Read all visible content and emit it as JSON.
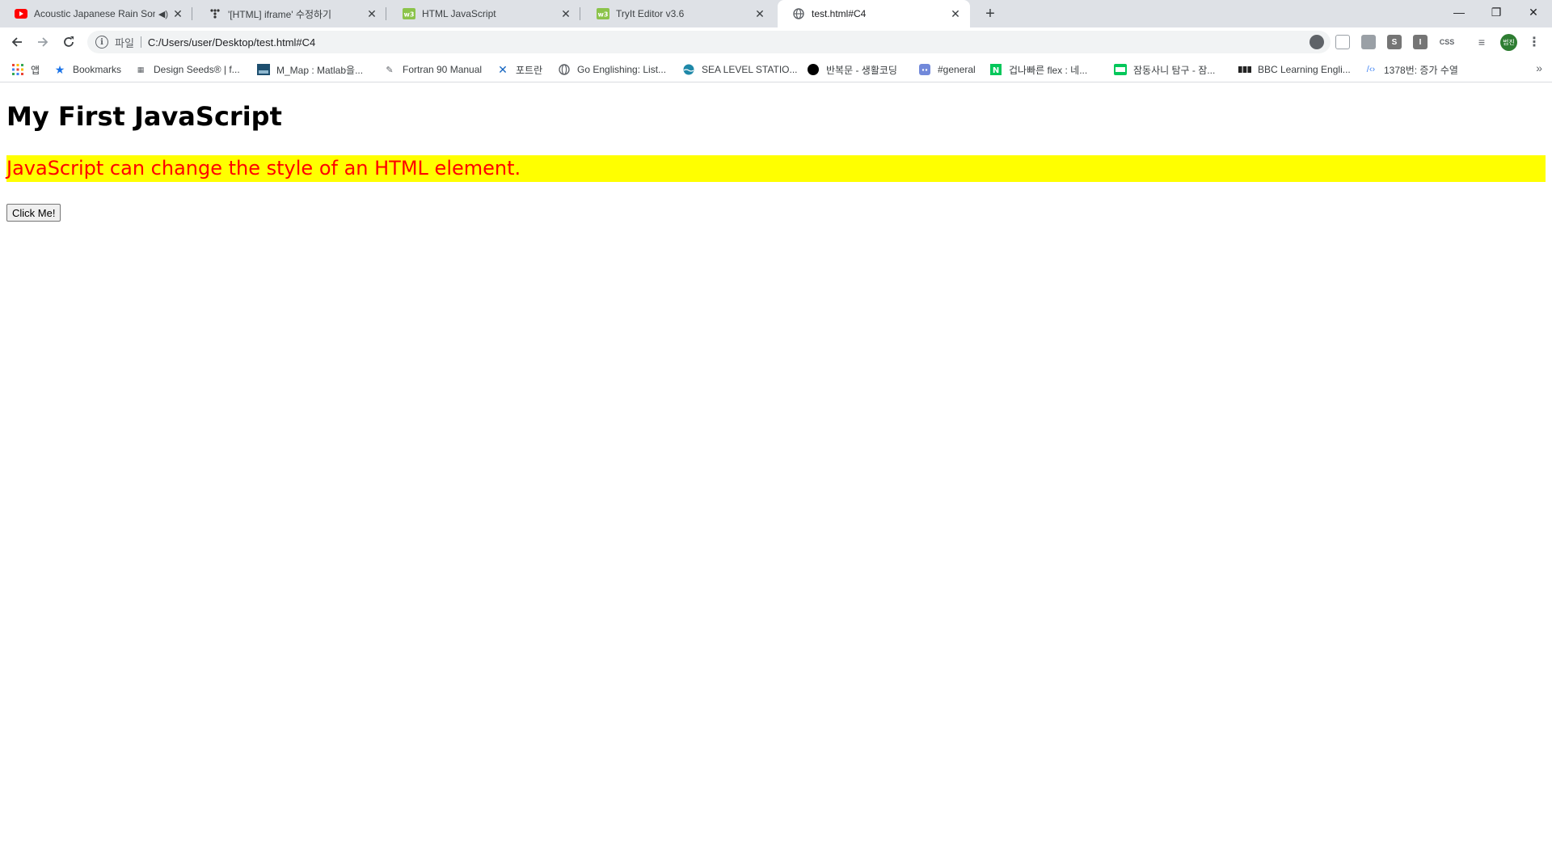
{
  "tabs": [
    {
      "title": "Acoustic Japanese Rain Son",
      "favicon": "youtube-icon",
      "audio": "speaker-icon"
    },
    {
      "title": "'[HTML] iframe' 수정하기",
      "favicon": "dots-icon"
    },
    {
      "title": "HTML JavaScript",
      "favicon": "w3schools-icon"
    },
    {
      "title": "TryIt Editor v3.6",
      "favicon": "w3schools-icon"
    },
    {
      "title": "test.html#C4",
      "favicon": "globe-icon",
      "active": true
    }
  ],
  "window": {
    "minimize": "—",
    "restore": "❐",
    "close": "✕",
    "new_tab": "+"
  },
  "omnibox": {
    "scheme_label": "파일",
    "url": "C:/Users/user/Desktop/test.html#C4"
  },
  "bookmarks": [
    {
      "label": "앱",
      "icon": "apps-grid-icon"
    },
    {
      "label": "Bookmarks",
      "icon": "star-icon"
    },
    {
      "label": "Design Seeds® | f...",
      "icon": "design-seeds-icon"
    },
    {
      "label": "M_Map : Matlab을...",
      "icon": "m-map-icon"
    },
    {
      "label": "Fortran 90 Manual",
      "icon": "fortran-icon"
    },
    {
      "label": "포트란",
      "icon": "cross-icon"
    },
    {
      "label": "Go Englishing: List...",
      "icon": "globe-icon"
    },
    {
      "label": "SEA LEVEL STATIO...",
      "icon": "sea-level-icon"
    },
    {
      "label": "반복문 - 생활코딩",
      "icon": "circle-icon"
    },
    {
      "label": "#general",
      "icon": "discord-icon"
    },
    {
      "label": "겁나빠른 flex : 네...",
      "icon": "naver-icon"
    },
    {
      "label": "잠동사니 탐구 - 잠...",
      "icon": "blog-icon"
    },
    {
      "label": "BBC Learning Engli...",
      "icon": "bbc-icon"
    },
    {
      "label": "1378번: 증가 수열",
      "icon": "code-icon"
    }
  ],
  "extensions": [
    {
      "name": "ext-circle",
      "label": "",
      "color": "#5f6368"
    },
    {
      "name": "ext-screen",
      "label": "",
      "color": "#9aa0a6"
    },
    {
      "name": "ext-mic",
      "label": "",
      "color": "#9aa0a6"
    },
    {
      "name": "ext-s",
      "label": "S",
      "color": "#757575"
    },
    {
      "name": "ext-i",
      "label": "I",
      "color": "#757575"
    },
    {
      "name": "ext-css",
      "label": "CSS",
      "color": "#ffffff"
    }
  ],
  "avatar_label": "범진",
  "page": {
    "heading": "My First JavaScript",
    "demo_text": "JavaScript can change the style of an HTML element.",
    "button_label": "Click Me!",
    "demo_bg": "#ffff00",
    "demo_color": "#ff0000"
  }
}
